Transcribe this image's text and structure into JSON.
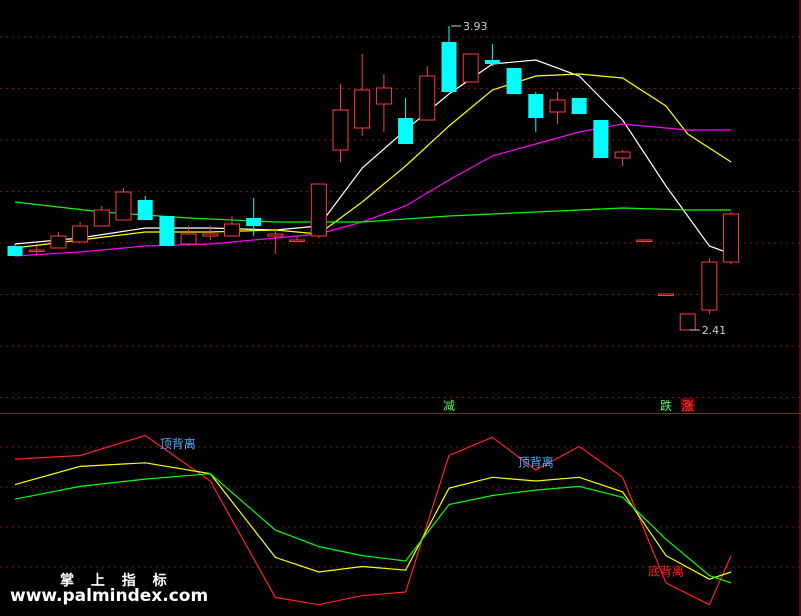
{
  "chart_data": [
    {
      "type": "candlestick",
      "title": "",
      "ylim": [
        2.1,
        4.02
      ],
      "grid": true,
      "candles": [
        {
          "o": 2.83,
          "h": 2.84,
          "l": 2.79,
          "c": 2.78
        },
        {
          "o": 2.81,
          "h": 2.83,
          "l": 2.78,
          "c": 2.81
        },
        {
          "o": 2.82,
          "h": 2.9,
          "l": 2.82,
          "c": 2.88
        },
        {
          "o": 2.85,
          "h": 2.95,
          "l": 2.85,
          "c": 2.93
        },
        {
          "o": 2.93,
          "h": 3.03,
          "l": 2.93,
          "c": 3.01
        },
        {
          "o": 2.96,
          "h": 3.12,
          "l": 2.96,
          "c": 3.1
        },
        {
          "o": 3.06,
          "h": 3.08,
          "l": 2.96,
          "c": 2.96
        },
        {
          "o": 2.98,
          "h": 2.98,
          "l": 2.83,
          "c": 2.83
        },
        {
          "o": 2.84,
          "h": 2.93,
          "l": 2.83,
          "c": 2.89
        },
        {
          "o": 2.88,
          "h": 2.93,
          "l": 2.86,
          "c": 2.89
        },
        {
          "o": 2.88,
          "h": 2.98,
          "l": 2.88,
          "c": 2.94
        },
        {
          "o": 2.97,
          "h": 3.07,
          "l": 2.88,
          "c": 2.93
        },
        {
          "o": 2.88,
          "h": 2.91,
          "l": 2.79,
          "c": 2.89
        },
        {
          "o": 2.86,
          "h": 2.88,
          "l": 2.86,
          "c": 2.86
        },
        {
          "o": 2.88,
          "h": 3.14,
          "l": 2.87,
          "c": 3.14
        },
        {
          "o": 3.31,
          "h": 3.64,
          "l": 3.25,
          "c": 3.51
        },
        {
          "o": 3.42,
          "h": 3.79,
          "l": 3.38,
          "c": 3.61
        },
        {
          "o": 3.54,
          "h": 3.69,
          "l": 3.4,
          "c": 3.62
        },
        {
          "o": 3.47,
          "h": 3.57,
          "l": 3.34,
          "c": 3.34
        },
        {
          "o": 3.46,
          "h": 3.73,
          "l": 3.46,
          "c": 3.68
        },
        {
          "o": 3.85,
          "h": 3.93,
          "l": 3.6,
          "c": 3.6
        },
        {
          "o": 3.65,
          "h": 3.79,
          "l": 3.65,
          "c": 3.79
        },
        {
          "o": 3.76,
          "h": 3.84,
          "l": 3.73,
          "c": 3.74
        },
        {
          "o": 3.72,
          "h": 3.72,
          "l": 3.59,
          "c": 3.59
        },
        {
          "o": 3.59,
          "h": 3.6,
          "l": 3.4,
          "c": 3.47
        },
        {
          "o": 3.5,
          "h": 3.6,
          "l": 3.44,
          "c": 3.56
        },
        {
          "o": 3.57,
          "h": 3.57,
          "l": 3.49,
          "c": 3.49
        },
        {
          "o": 3.46,
          "h": 3.46,
          "l": 3.27,
          "c": 3.27
        },
        {
          "o": 3.27,
          "h": 3.31,
          "l": 3.23,
          "c": 3.3
        },
        {
          "o": 2.86,
          "h": 2.86,
          "l": 2.86,
          "c": 2.86
        },
        {
          "o": 2.59,
          "h": 2.59,
          "l": 2.59,
          "c": 2.59
        },
        {
          "o": 2.41,
          "h": 2.49,
          "l": 2.41,
          "c": 2.49
        },
        {
          "o": 2.51,
          "h": 2.77,
          "l": 2.49,
          "c": 2.75
        },
        {
          "o": 2.75,
          "h": 3.0,
          "l": 2.74,
          "c": 2.99
        }
      ],
      "series": [
        {
          "color": "#ffffff",
          "x": [
            0,
            3,
            6,
            9,
            12,
            14,
            16,
            18,
            20,
            22,
            24,
            26,
            28,
            30,
            32,
            33
          ],
          "values": [
            2.84,
            2.87,
            2.92,
            2.92,
            2.91,
            2.93,
            3.22,
            3.41,
            3.59,
            3.74,
            3.76,
            3.68,
            3.46,
            3.13,
            2.83,
            2.79
          ]
        },
        {
          "color": "#ffff00",
          "x": [
            0,
            3,
            6,
            9,
            12,
            14,
            16,
            18,
            20,
            22,
            24,
            26,
            28,
            30,
            31,
            33
          ],
          "values": [
            2.82,
            2.86,
            2.9,
            2.9,
            2.91,
            2.89,
            3.05,
            3.23,
            3.43,
            3.61,
            3.68,
            3.69,
            3.67,
            3.53,
            3.39,
            3.25
          ]
        },
        {
          "color": "#ff00ff",
          "x": [
            0,
            3,
            6,
            9,
            12,
            14,
            16,
            18,
            20,
            22,
            24,
            26,
            28,
            30,
            31,
            33
          ],
          "values": [
            2.78,
            2.8,
            2.83,
            2.84,
            2.87,
            2.89,
            2.95,
            3.03,
            3.16,
            3.28,
            3.34,
            3.4,
            3.44,
            3.42,
            3.41,
            3.41
          ]
        },
        {
          "color": "#00ff00",
          "x": [
            0,
            4,
            8,
            12,
            16,
            20,
            24,
            28,
            31,
            33
          ],
          "values": [
            3.05,
            3.0,
            2.97,
            2.95,
            2.95,
            2.98,
            3.0,
            3.02,
            3.01,
            3.01
          ]
        }
      ],
      "annotations": [
        {
          "text": "3.93",
          "x": 20,
          "y": 3.93,
          "color": "#cccccc"
        },
        {
          "text": "2.41",
          "x": 31,
          "y": 2.41,
          "color": "#cccccc"
        }
      ],
      "markers": [
        {
          "text": "减",
          "x": 20,
          "color": "#55ff55"
        },
        {
          "text": "跌",
          "x": 30,
          "color": "#55ff55"
        },
        {
          "text": "涨",
          "x": 31,
          "color": "#ff4444",
          "bg": "#6b0000"
        }
      ]
    },
    {
      "type": "line",
      "title": "",
      "ylim": [
        0,
        100
      ],
      "series": [
        {
          "color": "#ff2222",
          "x": [
            0,
            3,
            6,
            9,
            12,
            14,
            16,
            18,
            20,
            22,
            24,
            26,
            28,
            30,
            32,
            33
          ],
          "values": [
            84,
            86,
            97,
            72,
            8,
            4,
            9,
            11,
            86,
            96,
            78,
            91,
            74,
            16,
            4,
            31
          ]
        },
        {
          "color": "#ffff00",
          "x": [
            0,
            3,
            6,
            9,
            12,
            14,
            16,
            18,
            20,
            22,
            24,
            26,
            28,
            30,
            32,
            33
          ],
          "values": [
            70,
            80,
            82,
            76,
            30,
            22,
            25,
            23,
            68,
            74,
            72,
            74,
            66,
            31,
            18,
            22
          ]
        },
        {
          "color": "#00ff00",
          "x": [
            0,
            3,
            6,
            9,
            12,
            14,
            16,
            18,
            20,
            22,
            24,
            26,
            28,
            30,
            32,
            33
          ],
          "values": [
            62,
            69,
            73,
            76,
            45,
            36,
            31,
            28,
            59,
            64,
            67,
            69,
            63,
            40,
            20,
            16
          ]
        }
      ],
      "labels": [
        {
          "text": "顶背离",
          "x": 7.5,
          "y": 90,
          "color": "#4fb0ff"
        },
        {
          "text": "顶背离",
          "x": 24,
          "y": 80,
          "color": "#4fb0ff"
        },
        {
          "text": "底背离",
          "x": 30,
          "y": 20,
          "color": "#ff2222"
        }
      ]
    }
  ],
  "watermark": {
    "cn": "掌 上 指 标",
    "url": "www.palmindex.com"
  }
}
